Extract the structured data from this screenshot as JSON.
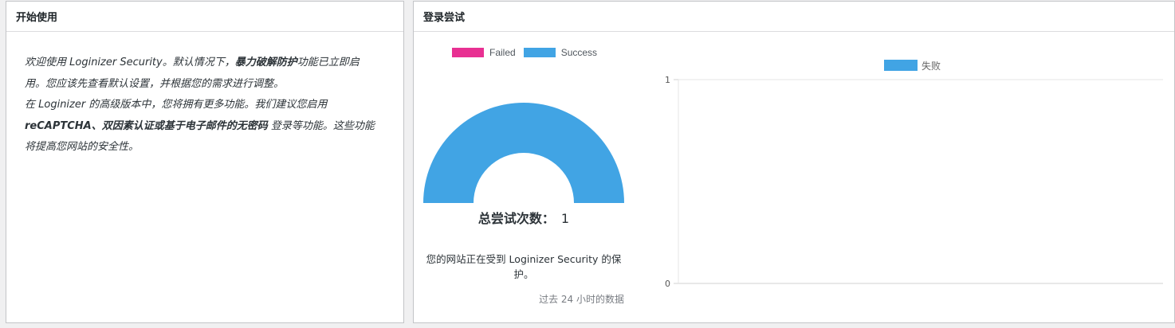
{
  "panels": {
    "left": {
      "title": "开始使用",
      "intro": {
        "p1_a": "欢迎使用 Loginizer Security。默认情况下，",
        "p1_b": "暴力破解防护",
        "p1_c": "功能已立即启用。您应该先查看默认设置，并根据您的需求进行调整。",
        "p2_a": "在 Loginizer 的高级版本中，您将拥有更多功能。我们建议您启用 ",
        "p2_b": "reCAPTCHA、双因素认证或基于电子邮件的无密码",
        "p2_c": " 登录等功能。这些功能将提高您网站的安全性。"
      }
    },
    "right": {
      "title": "登录尝试",
      "total_label": "总尝试次数：",
      "total_value": "1",
      "protect_text": "您的网站正在受到 Loginizer Security 的保护。",
      "period_text": "过去 24 小时的数据"
    }
  },
  "colors": {
    "failed": "#e83092",
    "success": "#41a4e4"
  },
  "chart_data": [
    {
      "type": "pie",
      "style": "half-doughnut",
      "categories": [
        "Failed",
        "Success"
      ],
      "values": [
        0,
        1
      ],
      "legend": "top"
    },
    {
      "type": "line",
      "series": [
        {
          "name": "失败",
          "values": []
        }
      ],
      "ylim": [
        0,
        1
      ],
      "yticks": [
        "0",
        "1"
      ],
      "legend": "top",
      "grid": true
    }
  ]
}
